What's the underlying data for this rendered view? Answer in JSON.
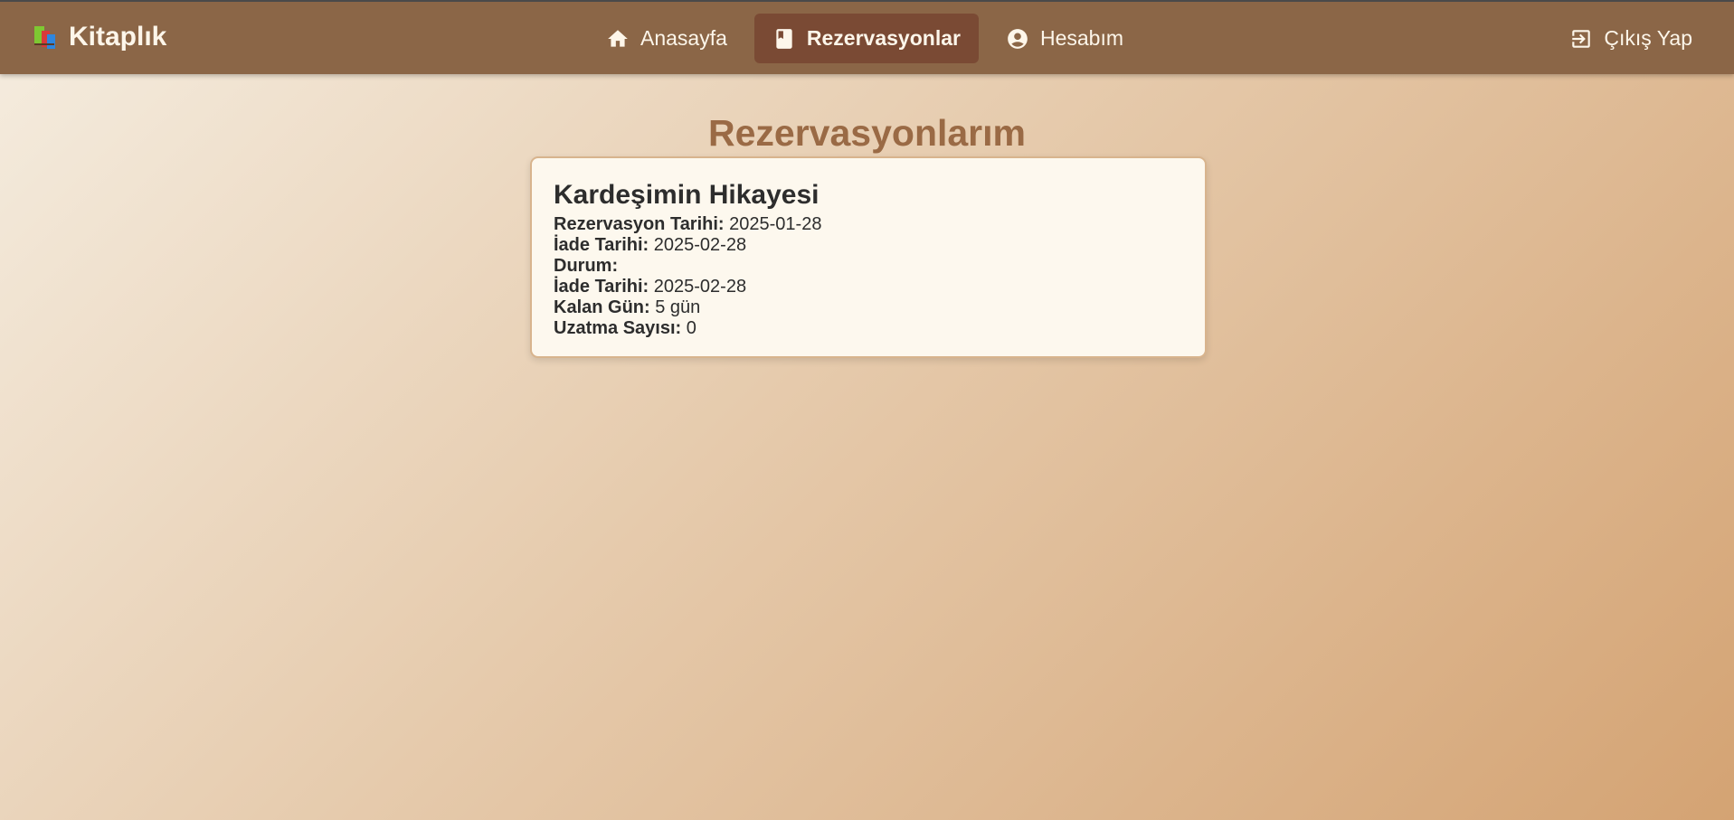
{
  "app": {
    "brand": "Kitaplık",
    "brand_icon": "books-icon"
  },
  "nav": {
    "items": [
      {
        "label": "Anasayfa",
        "icon": "home-icon",
        "active": false
      },
      {
        "label": "Rezervasyonlar",
        "icon": "book-icon",
        "active": true
      },
      {
        "label": "Hesabım",
        "icon": "account-circle-icon",
        "active": false
      }
    ],
    "logout": {
      "label": "Çıkış Yap",
      "icon": "logout-icon"
    }
  },
  "page": {
    "title": "Rezervasyonlarım"
  },
  "reservations": [
    {
      "book_title": "Kardeşimin Hikayesi",
      "fields": [
        {
          "label": "Rezervasyon Tarihi:",
          "value": "2025-01-28"
        },
        {
          "label": "İade Tarihi:",
          "value": "2025-02-28"
        },
        {
          "label": "Durum:",
          "value": ""
        },
        {
          "label": "İade Tarihi:",
          "value": "2025-02-28"
        },
        {
          "label": "Kalan Gün:",
          "value": "5 gün"
        },
        {
          "label": "Uzatma Sayısı:",
          "value": "0"
        }
      ]
    }
  ],
  "colors": {
    "navbar": "#8b6647",
    "nav_active": "#7a4a34",
    "title": "#9a6a45",
    "card_bg": "#fdf8ee",
    "card_border": "#d8b48d"
  }
}
